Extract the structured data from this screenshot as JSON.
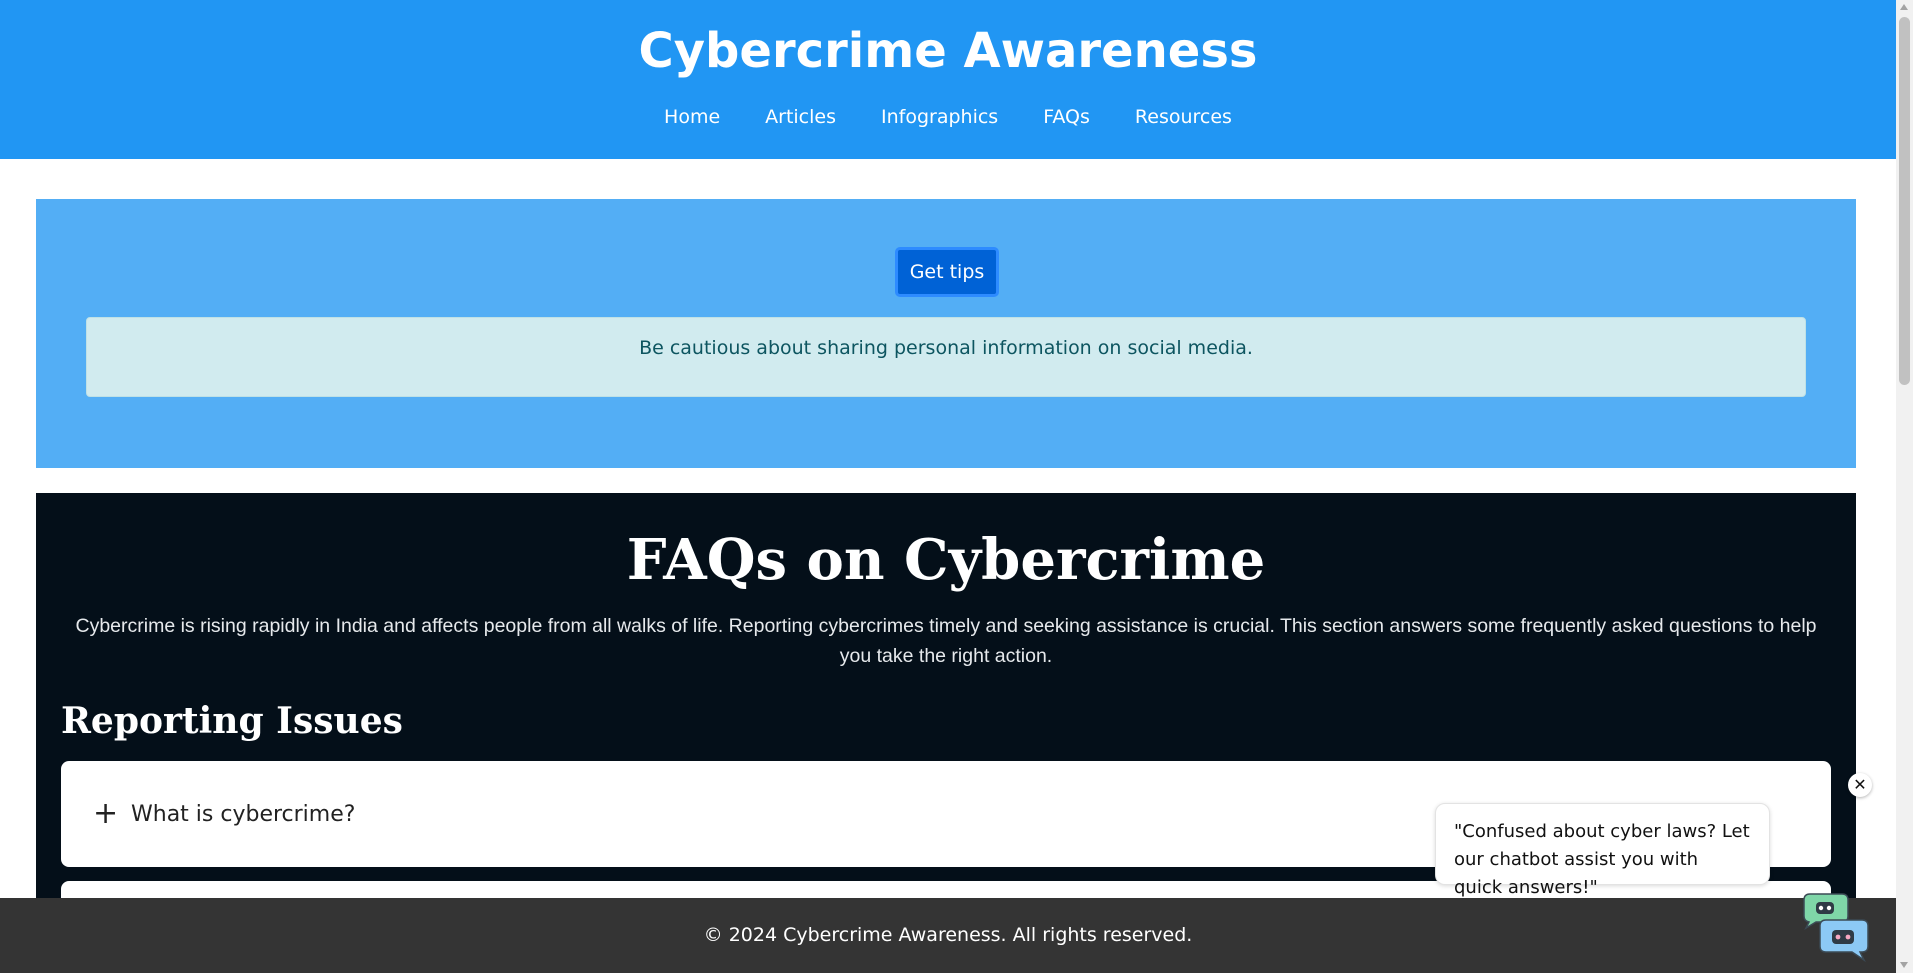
{
  "header": {
    "title": "Cybercrime Awareness",
    "nav": [
      "Home",
      "Articles",
      "Infographics",
      "FAQs",
      "Resources"
    ]
  },
  "tips": {
    "button_label": "Get tips",
    "message": "Be cautious about sharing personal information on social media."
  },
  "faq": {
    "title": "FAQs on Cybercrime",
    "intro": "Cybercrime is rising rapidly in India and affects people from all walks of life. Reporting cybercrimes timely and seeking assistance is crucial. This section answers some frequently asked questions to help you take the right action.",
    "category": "Reporting Issues",
    "items": [
      {
        "icon": "+",
        "question": "What is cybercrime?"
      }
    ]
  },
  "footer": {
    "text": "© 2024 Cybercrime Awareness. All rights reserved."
  },
  "chat": {
    "message": "\"Confused about cyber laws? Let our chatbot assist you with quick answers!\"",
    "close_glyph": "✕",
    "icon": "chatbot-icon"
  },
  "colors": {
    "header_bg": "#2196f3",
    "tips_bg": "#53aef5",
    "button_bg": "#0062d6",
    "tip_box_bg": "#d1ebef",
    "faq_bg": "#040f19",
    "footer_bg": "#343434"
  }
}
